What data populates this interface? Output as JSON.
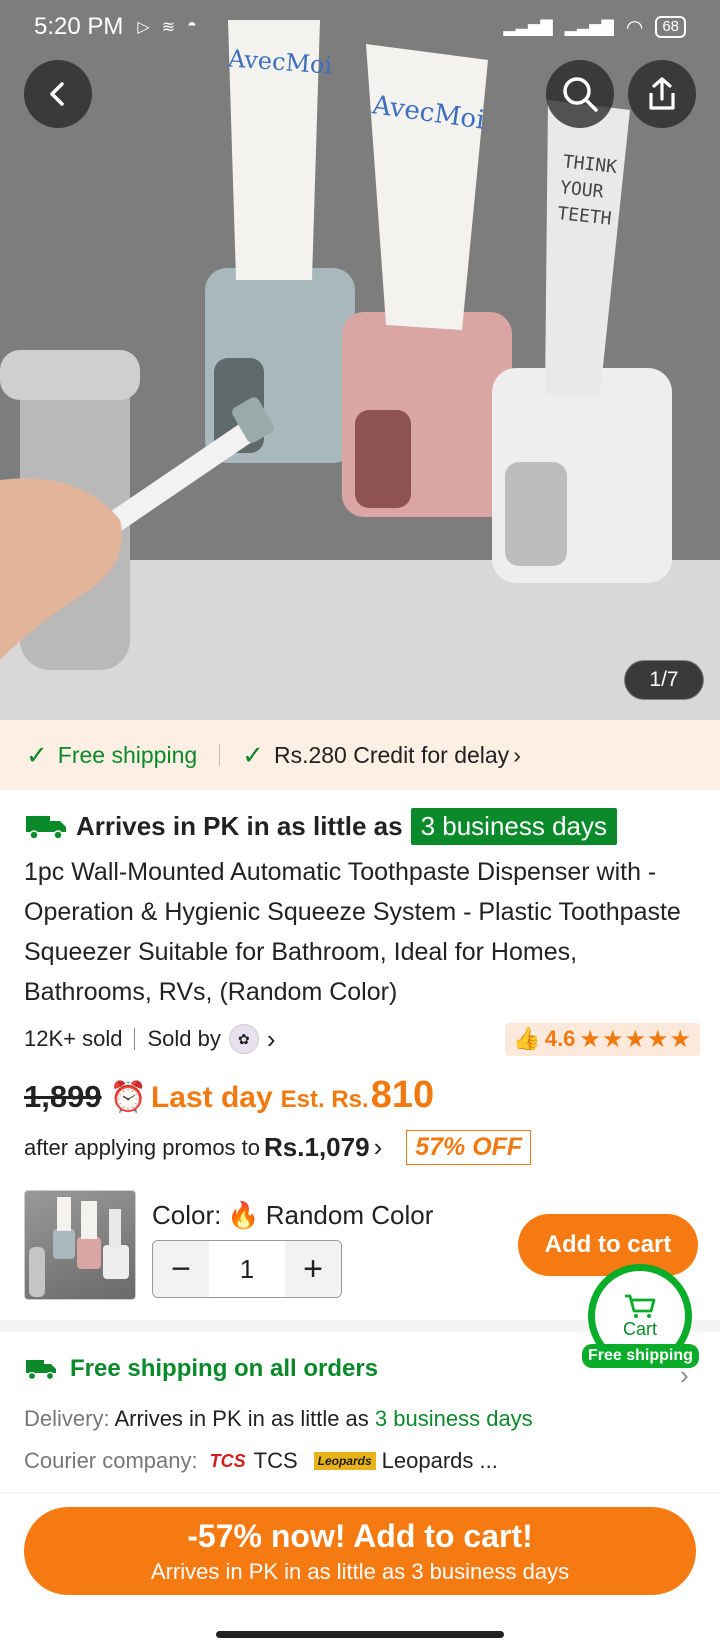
{
  "status_bar": {
    "time": "5:20 PM",
    "battery": "68"
  },
  "hero": {
    "pager": "1/7",
    "brand_1": "AvecMoi",
    "brand_2": "AvecMoi",
    "tube_3_text": [
      "THINK",
      "YOUR",
      "TEETH"
    ]
  },
  "shipping_strip": {
    "free_shipping": "Free shipping",
    "credit": "Rs.280 Credit for delay"
  },
  "arrival": {
    "text": "Arrives in PK in as little as",
    "days": "3 business days"
  },
  "product": {
    "title": "1pc Wall-Mounted Automatic Toothpaste Dispenser with - Operation & Hygienic Squeeze System - Plastic Toothpaste Squeezer Suitable for Bathroom, Ideal for Homes, Bathrooms, RVs, (Random Color)",
    "sold": "12K+ sold",
    "sold_by": "Sold by",
    "rating": "4.6",
    "stars": "★★★★★"
  },
  "price": {
    "old": "1,899",
    "last_day": "Last day",
    "est_label": "Est. Rs.",
    "est_value": "810",
    "promo_text": "after applying promos to",
    "promo_price": "Rs.1,079",
    "discount": "57% OFF"
  },
  "variant": {
    "color_label": "Color:",
    "color_value": "Random Color",
    "quantity": "1",
    "add_to_cart": "Add to cart"
  },
  "cart_float": {
    "label": "Cart",
    "tag": "Free shipping"
  },
  "shipping_info": {
    "headline": "Free shipping on all orders",
    "delivery_key": "Delivery:",
    "delivery_text": "Arrives in PK in as little as",
    "delivery_days": "3 business days",
    "courier_key": "Courier company:",
    "courier_1": "TCS",
    "courier_1_logo": "TCS",
    "courier_2_logo": "Leopards",
    "courier_2": "Leopards ..."
  },
  "cta": {
    "main": "-57% now! Add to cart!",
    "sub": "Arrives in PK in as little as 3 business days"
  },
  "colors": {
    "accent_orange": "#f57a12",
    "green": "#0a8a2a",
    "strip_bg": "#fdefe4"
  }
}
